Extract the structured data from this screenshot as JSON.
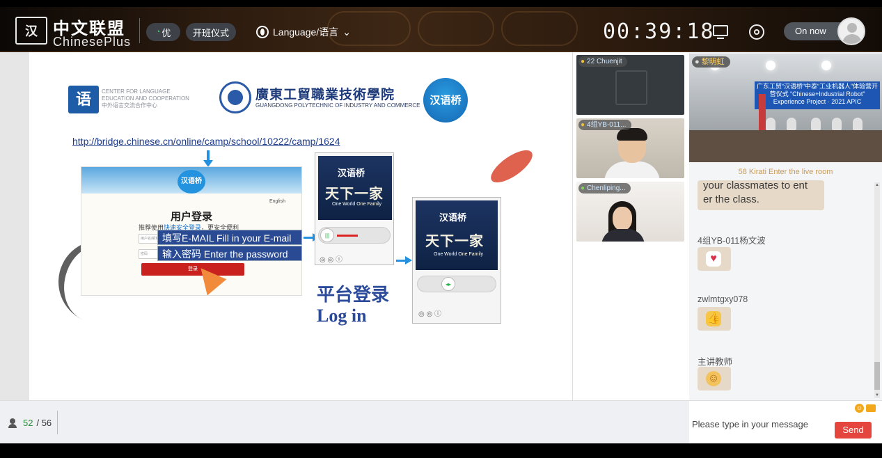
{
  "header": {
    "logo_seal": "汉",
    "logo_cn": "中文联盟",
    "logo_en": "ChinesePlus",
    "quality_label": "优",
    "ceremony_label": "开班仪式",
    "language_label": "Language/语言",
    "timer": "00:39:18",
    "status_label": "On now"
  },
  "slide": {
    "logo1_mark": "语",
    "logo1_text": "CENTER FOR LANGUAGE EDUCATION AND COOPERATION 中外语言交流合作中心",
    "gp_name_cn": "廣東工貿職業技術學院",
    "gp_name_en": "GUANGDONG POLYTECHNIC OF INDUSTRY AND COMMERCE",
    "bridge_logo": "汉语桥",
    "url": "http://bridge.chinese.cn/online/camp/school/10222/camp/1624",
    "login_page": {
      "logo": "汉语桥",
      "english": "English",
      "title": "用户登录",
      "sub_prefix": "推荐使用",
      "sub_highlight": "快速安全登录",
      "sub_suffix": "，更安全便利",
      "field1": "用户名/邮箱",
      "field2": "密码",
      "button": "登录"
    },
    "callout_email": "填写E-MAIL Fill in your E-mail",
    "callout_password": "输入密码 Enter the password",
    "poster_logo": "汉语桥",
    "poster_title": "天下一家",
    "poster_en": "One World One Family",
    "platform_cn": "平台登录",
    "platform_en": "Log in"
  },
  "videos": [
    {
      "name": "22 Chuenjit"
    },
    {
      "name": "4组YB-011..."
    },
    {
      "name": "Chenliping..."
    }
  ],
  "main_video": {
    "name": "黎明虹",
    "banner": "广东工贸“汉语桥”中泰“工业机器人”体验营开营仪式 “Chinese+Industrial Robot” Experience Project · 2021 APIC"
  },
  "chat": {
    "notice": "58 Kirati Enter the live room",
    "prev_message": "your classmates to ent er the class.",
    "messages": [
      {
        "name": "4组YB-011杨文波",
        "emoji": "hearts-sticker"
      },
      {
        "name": "zwlmtgxy078",
        "emoji": "thumbs-up-sticker"
      },
      {
        "name": "主讲教师",
        "emoji": "smile-sticker"
      }
    ]
  },
  "bottom": {
    "current": "52",
    "total": "/ 56"
  },
  "composer": {
    "placeholder": "Please type in your message",
    "send_label": "Send"
  },
  "colors": {
    "send": "#e4453d",
    "chat_bubble": "#e6d9c8",
    "notice": "#c99b58",
    "count_current": "#2d8a3e"
  }
}
